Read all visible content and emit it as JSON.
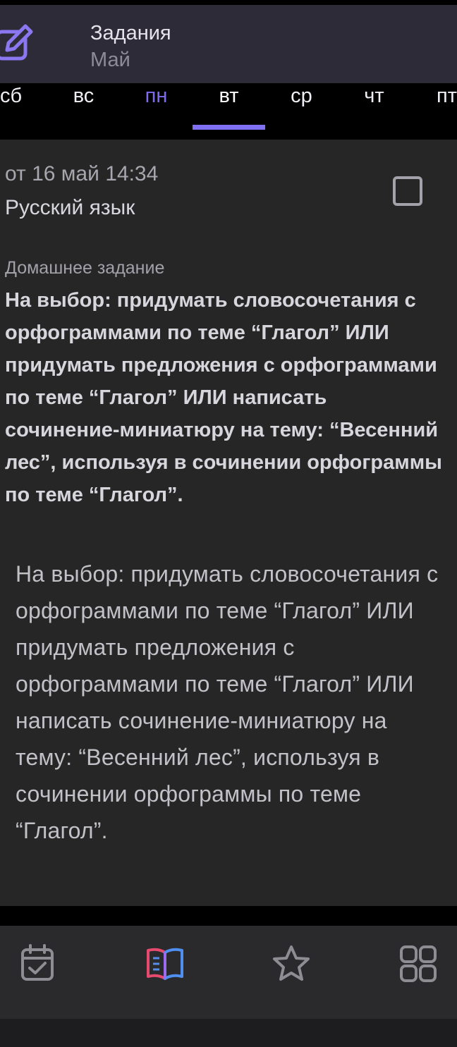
{
  "header": {
    "title": "Задания",
    "subtitle": "Май"
  },
  "days": [
    {
      "label": "сб",
      "state": "normal"
    },
    {
      "label": "вс",
      "state": "normal"
    },
    {
      "label": "пн",
      "state": "today"
    },
    {
      "label": "вт",
      "state": "selected"
    },
    {
      "label": "ср",
      "state": "normal"
    },
    {
      "label": "чт",
      "state": "normal"
    },
    {
      "label": "пт",
      "state": "normal"
    }
  ],
  "task": {
    "date": "от 16 май 14:34",
    "subject": "Русский язык",
    "section_label": "Домашнее задание",
    "short_text": "На выбор: придумать словосочетания с орфограммами по теме “Глагол” ИЛИ придумать предложения с орфограммами по теме “Глагол” ИЛИ написать сочинение-миниатюру на тему: “Весенний  лес”, используя в сочинении орфограммы по теме “Глагол”.",
    "full_text": "На выбор: придумать словосочетания с орфограммами по теме “Глагол” ИЛИ придумать предложения с орфограммами по теме “Глагол” ИЛИ написать сочинение-миниатюру на тему: “Весенний лес”, используя в сочинении орфограммы по теме “Глагол”.",
    "done": false
  },
  "bottom_nav": [
    {
      "icon": "calendar-check-icon",
      "active": false
    },
    {
      "icon": "book-icon",
      "active": true
    },
    {
      "icon": "star-icon",
      "active": false
    },
    {
      "icon": "grid-icon",
      "active": false
    }
  ],
  "colors": {
    "accent": "#7f6ff2",
    "header_bg": "#2e2b38",
    "card_bg": "#262626",
    "nav_bg": "#2a2a2c"
  }
}
